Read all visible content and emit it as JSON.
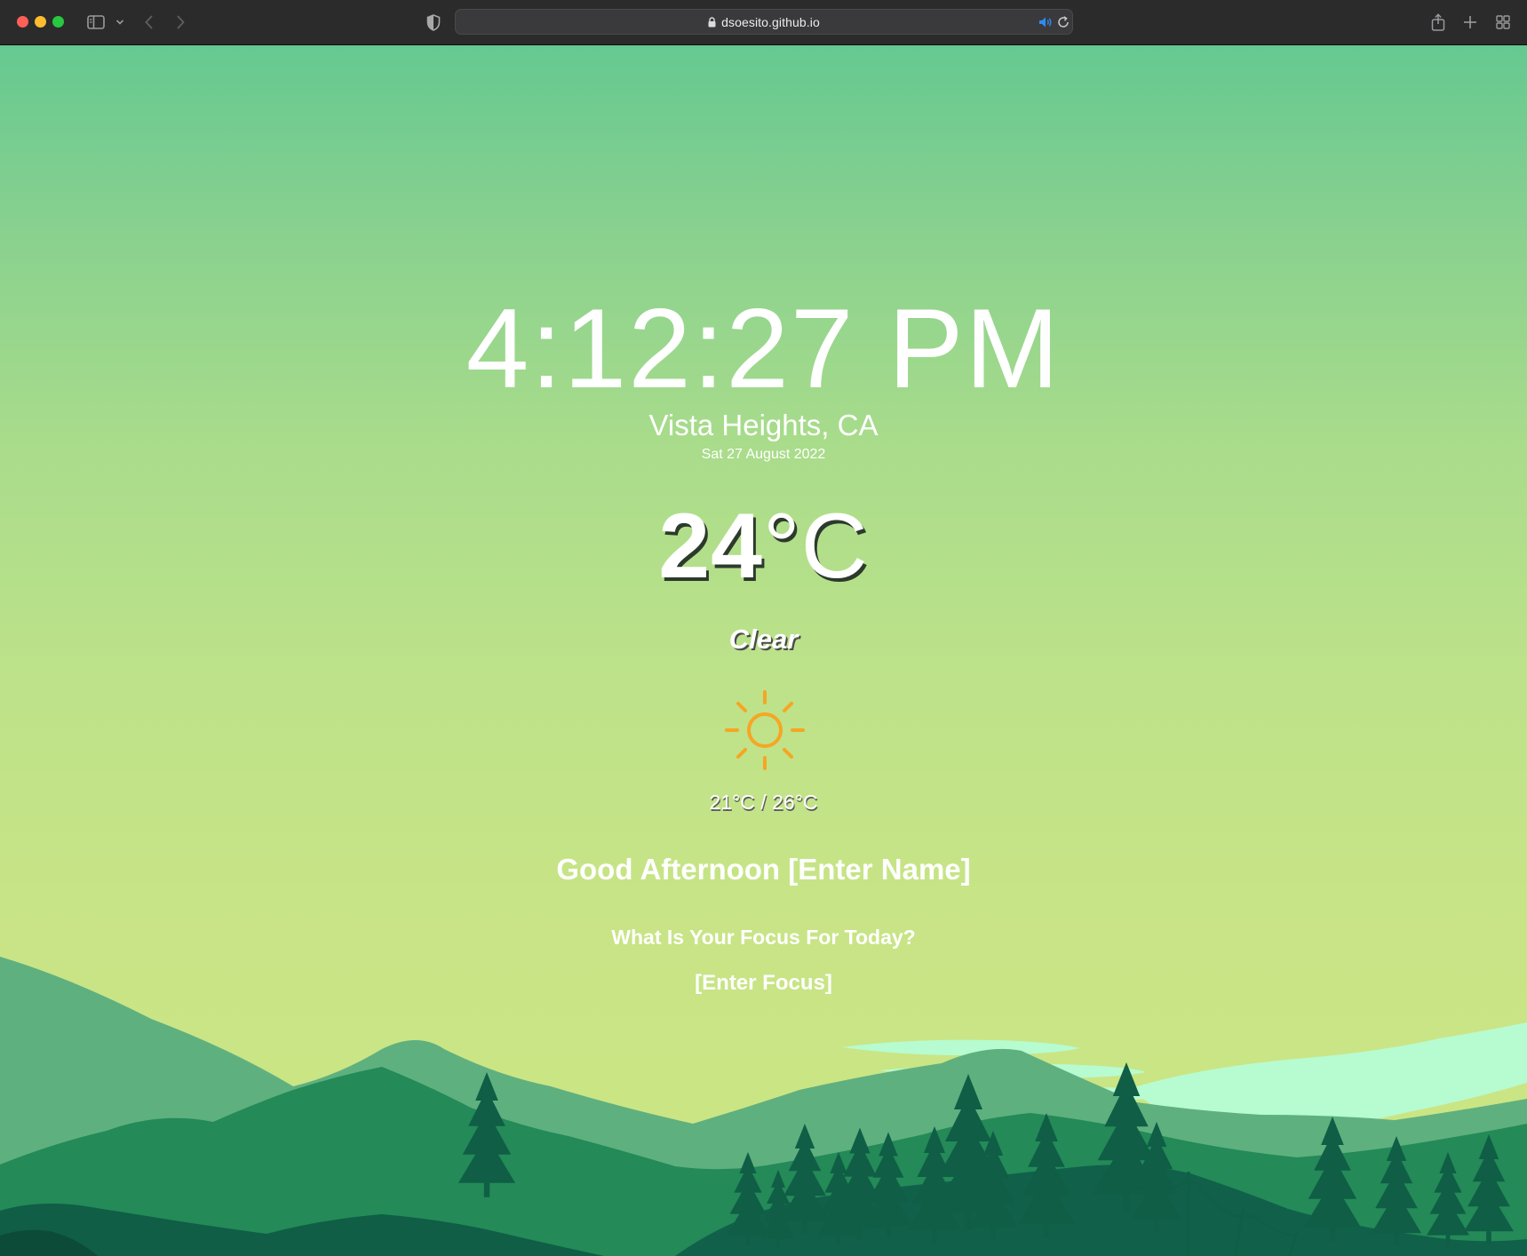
{
  "browser": {
    "url": "dsoesito.github.io",
    "icons": {
      "close": "close-dot",
      "minimize": "minimize-dot",
      "zoom": "zoom-dot",
      "sidebar": "sidebar-icon",
      "sidebar_menu": "chevron-down-icon",
      "back": "chevron-left-icon",
      "forward": "chevron-right-icon",
      "privacy": "shield-icon",
      "lock": "lock-icon",
      "audio": "speaker-icon",
      "reload": "reload-icon",
      "share": "share-icon",
      "new_tab": "plus-icon",
      "tab_overview": "grid-icon"
    },
    "colors": {
      "audio_icon": "#2d8cf0"
    }
  },
  "page": {
    "time": "4:12:27 PM",
    "location": "Vista Heights, CA",
    "date": "Sat 27 August 2022",
    "temperature": {
      "value": "24",
      "unit": "°C"
    },
    "condition": "Clear",
    "weather_icon": "sun-icon",
    "temp_range": "21°C / 26°C",
    "greeting": "Good Afternoon [Enter Name]",
    "focus_question": "What Is Your Focus For Today?",
    "focus_value": "[Enter Focus]"
  },
  "colors": {
    "sky_top": "#65c991",
    "sky_bottom": "#cde683",
    "sun": "#f6a623",
    "text": "#ffffff",
    "mountain_light": "#5fb07f",
    "mountain_mid": "#238a58",
    "forest_dark": "#0f5e45",
    "clouds": "#b7fbd0"
  }
}
